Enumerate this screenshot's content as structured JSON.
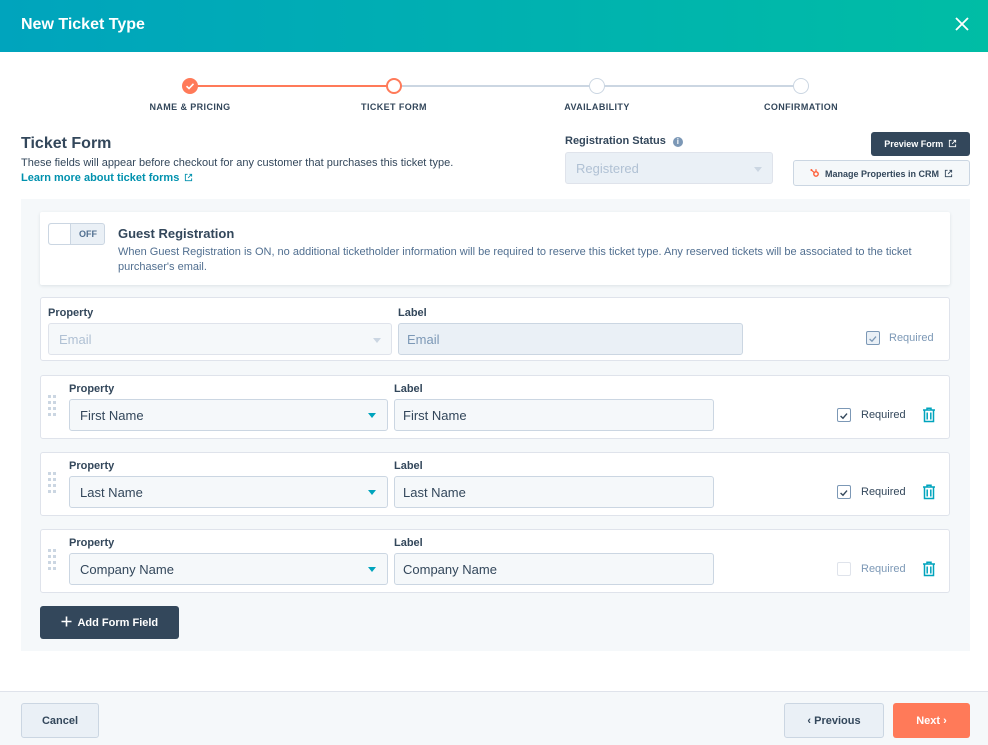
{
  "modal": {
    "title": "New Ticket Type",
    "close_icon": "close-icon"
  },
  "stepper": {
    "steps": [
      {
        "label": "NAME & PRICING",
        "state": "complete"
      },
      {
        "label": "TICKET FORM",
        "state": "active"
      },
      {
        "label": "AVAILABILITY",
        "state": "upcoming"
      },
      {
        "label": "CONFIRMATION",
        "state": "upcoming"
      }
    ]
  },
  "form_header": {
    "title": "Ticket Form",
    "description": "These fields will appear before checkout for any customer that purchases this ticket type.",
    "learn_more": "Learn more about ticket forms"
  },
  "registration": {
    "label": "Registration Status",
    "value": "Registered"
  },
  "actions": {
    "preview_form": "Preview Form",
    "manage_properties": "Manage Properties in CRM"
  },
  "guest_registration": {
    "toggle_state": "OFF",
    "title": "Guest Registration",
    "description": "When Guest Registration is ON, no additional ticketholder information will be required to reserve this ticket type. Any reserved tickets will be associated to the ticket purchaser's email."
  },
  "field_labels": {
    "property": "Property",
    "label": "Label",
    "required": "Required"
  },
  "fields": [
    {
      "property": "Email",
      "label": "Email",
      "required": true,
      "locked": true
    },
    {
      "property": "First Name",
      "label": "First Name",
      "required": true,
      "locked": false
    },
    {
      "property": "Last Name",
      "label": "Last Name",
      "required": true,
      "locked": false
    },
    {
      "property": "Company Name",
      "label": "Company Name",
      "required": false,
      "locked": false
    }
  ],
  "add_field": "Add Form Field",
  "footer": {
    "cancel": "Cancel",
    "previous": "Previous",
    "next": "Next"
  },
  "colors": {
    "accent": "#00a4bd",
    "primary_action": "#ff7a59",
    "dark": "#33475b"
  }
}
